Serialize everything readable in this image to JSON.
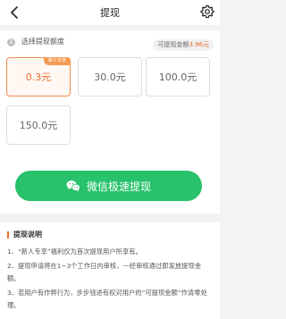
{
  "header": {
    "title": "提现",
    "back_icon": "chevron-left-icon",
    "settings_icon": "gear-icon"
  },
  "amount_section": {
    "step_number": "1",
    "label": "选择提现额度",
    "balance_label": "可提现金额",
    "balance_value": "3.96元",
    "options": [
      {
        "label": "0.3元",
        "badge": "新人专享",
        "selected": true
      },
      {
        "label": "30.0元",
        "selected": false
      },
      {
        "label": "100.0元",
        "selected": false
      },
      {
        "label": "150.0元",
        "selected": false
      }
    ]
  },
  "cta": {
    "label": "微信极速提现",
    "icon": "wechat-icon",
    "color": "#27c26b"
  },
  "notes": {
    "title": "提现说明",
    "rules": [
      "1、“新人专享”福利仅为首次提现用户所享有。",
      "2、提现申请将在1~3个工作日内审核，一经审核通过即发放提现金额。",
      "3、若用户有作弊行为，步步钱进有权对用户的“可提现金额”作清零处理。"
    ]
  },
  "colors": {
    "accent": "#ee6c2b",
    "selected_border": "#f08a4b",
    "badge": "#f59b52"
  }
}
